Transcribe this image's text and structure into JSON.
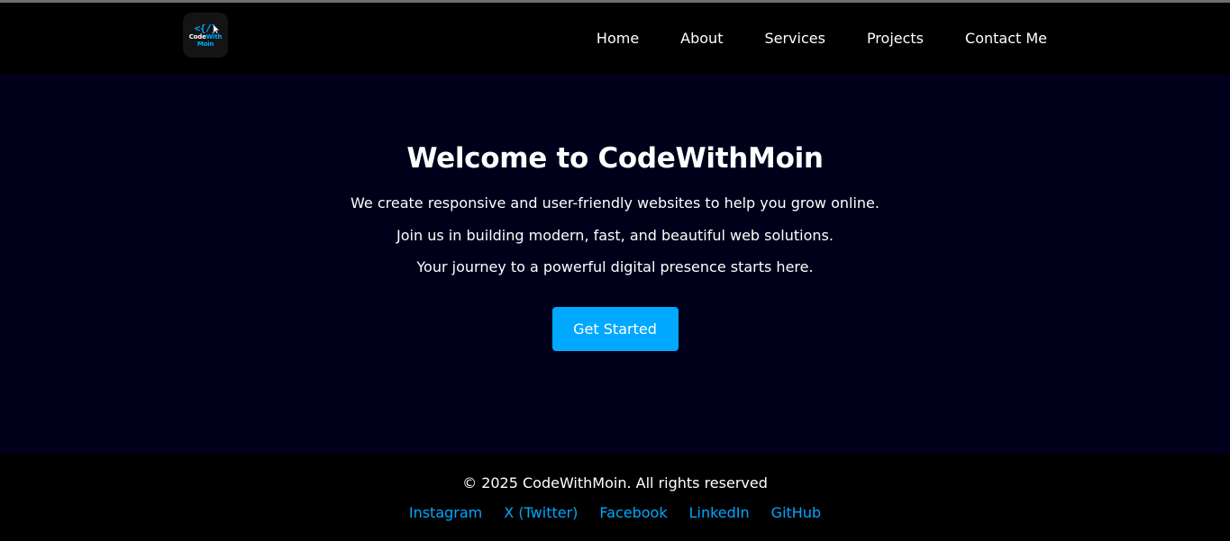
{
  "brand": {
    "logo_line1": "Code",
    "logo_line1_accent": "With",
    "logo_line2": "Moin",
    "logo_mark": "<{/}",
    "accent_color": "#00a8ff"
  },
  "nav": {
    "items": [
      {
        "label": "Home"
      },
      {
        "label": "About"
      },
      {
        "label": "Services"
      },
      {
        "label": "Projects"
      },
      {
        "label": "Contact Me"
      }
    ]
  },
  "hero": {
    "title": "Welcome to CodeWithMoin",
    "lines": [
      "We create responsive and user-friendly websites to help you grow online.",
      "Join us in building modern, fast, and beautiful web solutions.",
      "Your journey to a powerful digital presence starts here."
    ],
    "cta_label": "Get Started",
    "background": "#00001b"
  },
  "footer": {
    "copyright": "© 2025 CodeWithMoin. All rights reserved",
    "social": [
      {
        "label": "Instagram"
      },
      {
        "label": "X (Twitter)"
      },
      {
        "label": "Facebook"
      },
      {
        "label": "LinkedIn"
      },
      {
        "label": "GitHub"
      }
    ]
  }
}
